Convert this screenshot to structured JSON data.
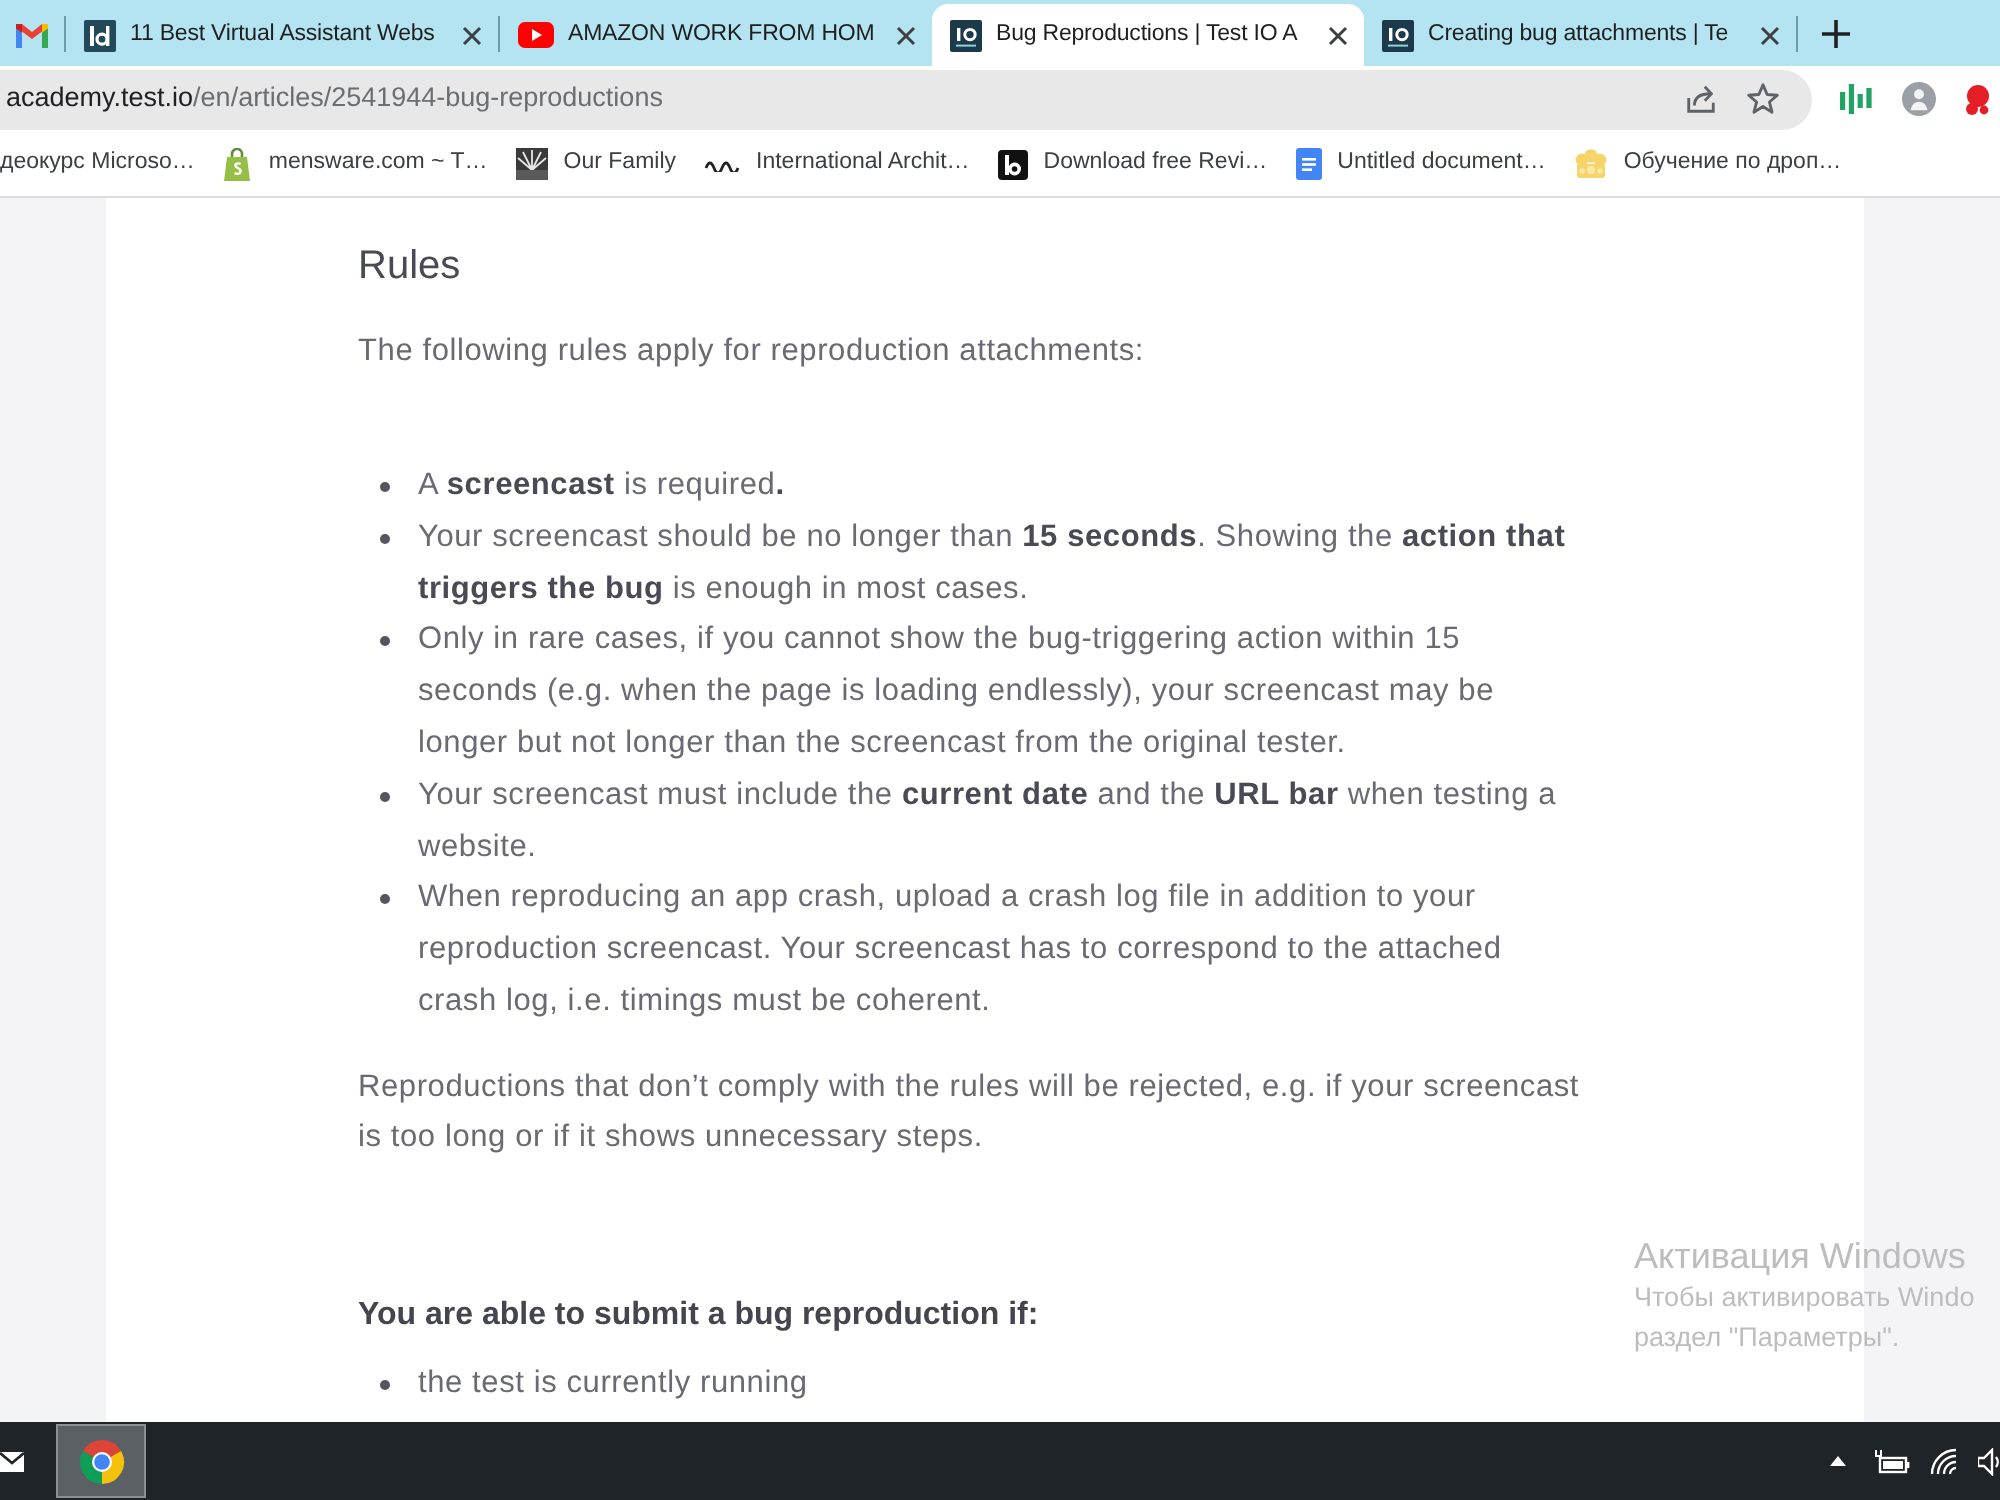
{
  "browser": {
    "tabs": [
      {
        "kind": "pinned",
        "selected": false
      },
      {
        "kind": "page",
        "title": "11 Best Virtual Assistant Webs",
        "selected": false
      },
      {
        "kind": "page",
        "title": "AMAZON WORK FROM HOM",
        "selected": false
      },
      {
        "kind": "page",
        "title": "Bug Reproductions | Test IO A",
        "selected": true
      },
      {
        "kind": "page",
        "title": "Creating bug attachments | Te",
        "selected": false
      }
    ],
    "address_bar": {
      "domain": "academy.test.io",
      "path": "/en/articles/2541944-bug-reproductions"
    },
    "bookmarks": [
      {
        "label": "деокурс Microso…"
      },
      {
        "label": "mensware.com ~ T…"
      },
      {
        "label": "Our Family"
      },
      {
        "label": "International Archit…"
      },
      {
        "label": "Download free Revi…"
      },
      {
        "label": "Untitled document…"
      },
      {
        "label": "Обучение по дроп…"
      }
    ]
  },
  "article": {
    "heading": "Rules",
    "intro": "The following rules apply for reproduction attachments:",
    "rules": [
      "A **screencast** is required**.**",
      "Your screencast should be no longer than **15 seconds**. Showing the **action that triggers the bug** is enough in most cases.",
      "Only in rare cases, if you cannot show the bug-triggering action within 15 seconds (e.g. when the page is loading endlessly), your screencast may be longer but not longer than the screencast from the original tester.",
      "Your screencast must include the **current date** and the **URL bar** when testing a website.",
      "When reproducing an app crash, upload a crash log file in addition to your reproduction screencast. Your screencast has to correspond to the attached crash log, i.e. timings must be coherent."
    ],
    "note": "Reproductions that don’t comply with the rules will be rejected, e.g. if your screencast is too long or if it shows unnecessary steps.",
    "subheading": "You are able to submit a bug reproduction if:",
    "conditions": [
      "the test is currently running"
    ]
  },
  "activation_notice": {
    "title": "Активация Windows",
    "lines": [
      "Чтобы активировать Windo",
      "раздел \"Параметры\"."
    ]
  },
  "taskbar": {
    "apps": [
      {
        "selected": false
      },
      {
        "selected": true
      }
    ]
  }
}
